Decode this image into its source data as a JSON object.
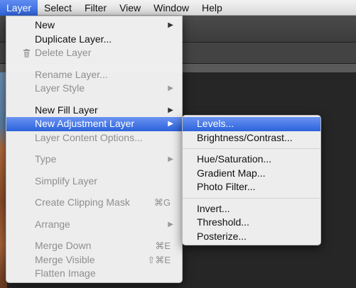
{
  "menubar": {
    "items": [
      {
        "label": "Layer",
        "active": true
      },
      {
        "label": "Select"
      },
      {
        "label": "Filter"
      },
      {
        "label": "View"
      },
      {
        "label": "Window"
      },
      {
        "label": "Help"
      }
    ]
  },
  "layer_menu": {
    "new": "New",
    "duplicate_layer": "Duplicate Layer...",
    "delete_layer": "Delete Layer",
    "rename_layer": "Rename Layer...",
    "layer_style": "Layer Style",
    "new_fill_layer": "New Fill Layer",
    "new_adjustment_layer": "New Adjustment Layer",
    "layer_content_options": "Layer Content Options...",
    "type": "Type",
    "simplify_layer": "Simplify Layer",
    "create_clipping_mask": "Create Clipping Mask",
    "create_clipping_mask_shortcut": "⌘G",
    "arrange": "Arrange",
    "merge_down": "Merge Down",
    "merge_down_shortcut": "⌘E",
    "merge_visible": "Merge Visible",
    "merge_visible_shortcut": "⇧⌘E",
    "flatten_image": "Flatten Image"
  },
  "adjustment_submenu": {
    "levels": "Levels...",
    "brightness_contrast": "Brightness/Contrast...",
    "hue_saturation": "Hue/Saturation...",
    "gradient_map": "Gradient Map...",
    "photo_filter": "Photo Filter...",
    "invert": "Invert...",
    "threshold": "Threshold...",
    "posterize": "Posterize..."
  },
  "colors": {
    "highlight": "#2c62db",
    "disabled_text": "#8f8f8f"
  }
}
